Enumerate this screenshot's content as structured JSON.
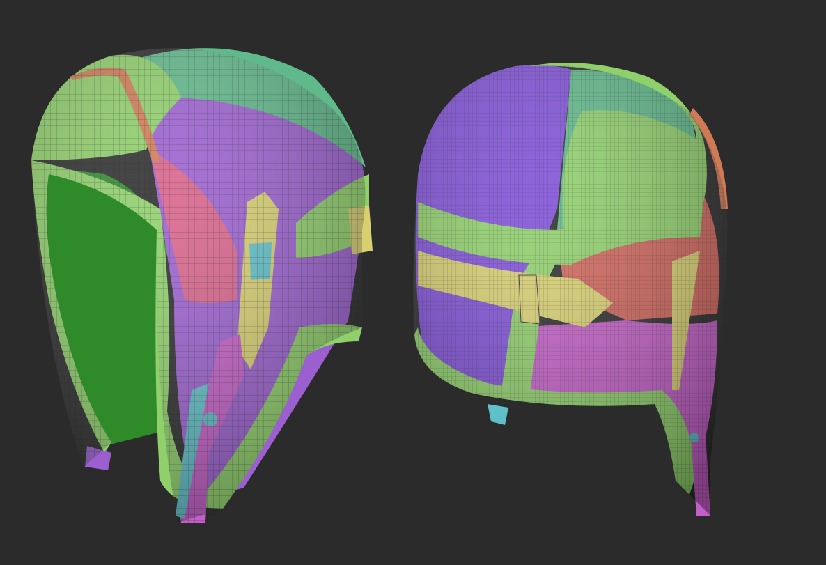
{
  "colors": {
    "background": "#2b2b2b",
    "green_light": "#8fd06a",
    "green_dark": "#2f8a2a",
    "teal": "#5fb98a",
    "purple": "#9b5fd0",
    "violet": "#7f4fd8",
    "magenta": "#c45ec8",
    "pink": "#d8628a",
    "salmon": "#d0645a",
    "orange": "#d07a55",
    "yellow": "#d8d070",
    "cyan": "#5fc0c8",
    "wire": "#1d2a1a"
  }
}
